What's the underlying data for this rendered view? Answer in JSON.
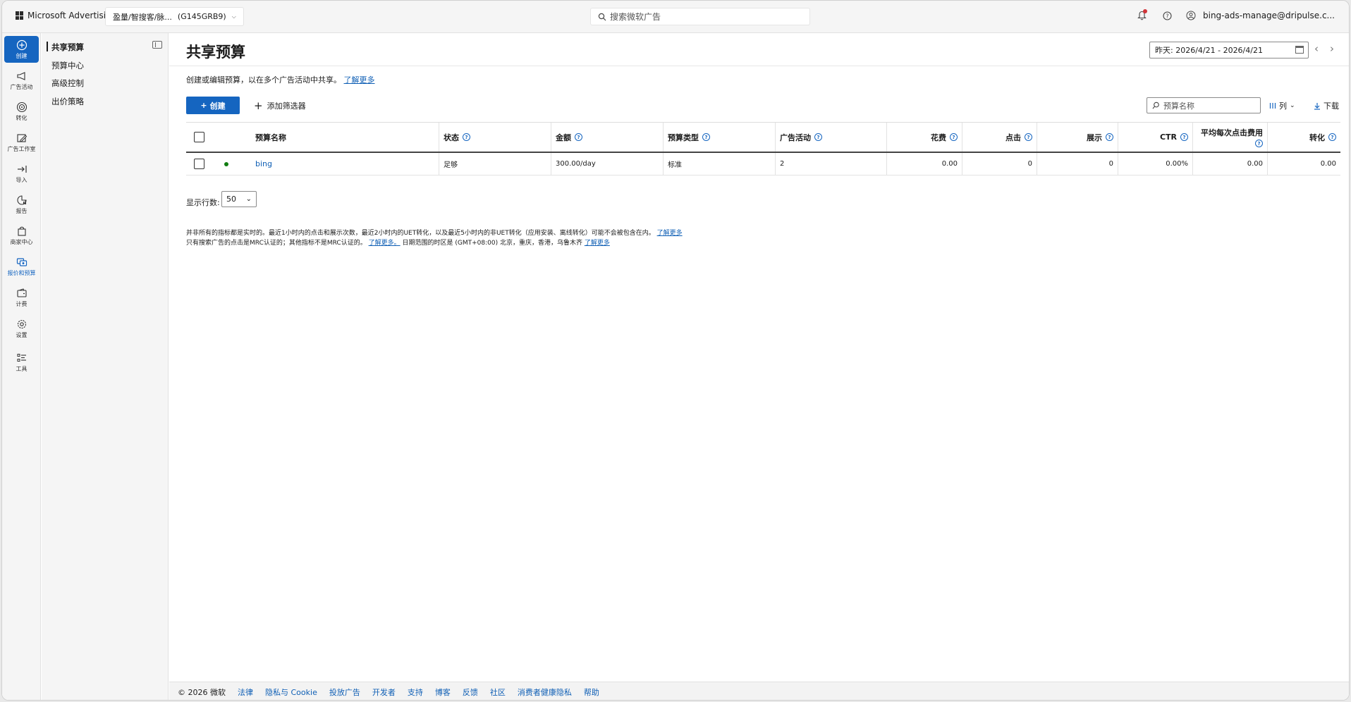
{
  "topbar": {
    "brand": "Microsoft Advertising",
    "account_name": "盈量/智搜客/脉...",
    "account_id": "(G145GRB9)",
    "search_placeholder": "搜索微软广告",
    "user_email": "bing-ads-manage@dripulse.c..."
  },
  "rail": [
    {
      "label": "创建",
      "icon": "plus-circle-icon"
    },
    {
      "label": "广告活动",
      "icon": "megaphone-icon"
    },
    {
      "label": "转化",
      "icon": "target-icon"
    },
    {
      "label": "广告工作室",
      "icon": "edit-image-icon"
    },
    {
      "label": "导入",
      "icon": "import-icon"
    },
    {
      "label": "报告",
      "icon": "report-icon"
    },
    {
      "label": "商家中心",
      "icon": "shopping-bag-icon"
    },
    {
      "label": "报价和预算",
      "icon": "budget-icon"
    },
    {
      "label": "计费",
      "icon": "wallet-icon"
    },
    {
      "label": "设置",
      "icon": "gear-icon"
    },
    {
      "label": "工具",
      "icon": "tools-icon"
    }
  ],
  "subnav": {
    "items": [
      "共享预算",
      "预算中心",
      "高级控制",
      "出价策略"
    ]
  },
  "page": {
    "title": "共享预算",
    "date_range": "昨天: 2026/4/21 - 2026/4/21",
    "description": "创建或编辑预算，以在多个广告活动中共享。",
    "learn_more": "了解更多",
    "create_label": "创建",
    "add_filter_label": "添加筛选器",
    "name_search_placeholder": "预算名称",
    "columns_label": "列",
    "download_label": "下载"
  },
  "table": {
    "headers": [
      "预算名称",
      "状态",
      "金额",
      "预算类型",
      "广告活动",
      "花费",
      "点击",
      "展示",
      "CTR",
      "平均每次点击费用",
      "转化"
    ],
    "rows": [
      {
        "name": "bing",
        "status": "足够",
        "amount": "300.00/day",
        "type": "标准",
        "campaigns": "2",
        "spend": "0.00",
        "clicks": "0",
        "impressions": "0",
        "ctr": "0.00%",
        "avg_cpc": "0.00",
        "conversions": "0.00"
      }
    ]
  },
  "pagination": {
    "rows_label": "显示行数:",
    "rows_value": "50"
  },
  "notes": {
    "line1": "并非所有的指标都是实时的。最近1小时内的点击和展示次数，最近2小时内的UET转化，以及最近5小时内的非UET转化（应用安装、离线转化）可能不会被包含在内。",
    "line1_link": "了解更多",
    "line2": "只有搜索广告的点击是MRC认证的；其他指标不是MRC认证的。",
    "line2_link": "了解更多。",
    "line2_tail": "日期范围的时区是 (GMT+08:00) 北京，重庆，香港，乌鲁木齐",
    "line2_link2": "了解更多"
  },
  "footer": {
    "copyright": "© 2026 微软",
    "links": [
      "法律",
      "隐私与 Cookie",
      "投放广告",
      "开发者",
      "支持",
      "博客",
      "反馈",
      "社区",
      "消费者健康隐私",
      "帮助"
    ]
  },
  "colors": {
    "accent": "#1565c0",
    "status_ok": "#107c10"
  }
}
